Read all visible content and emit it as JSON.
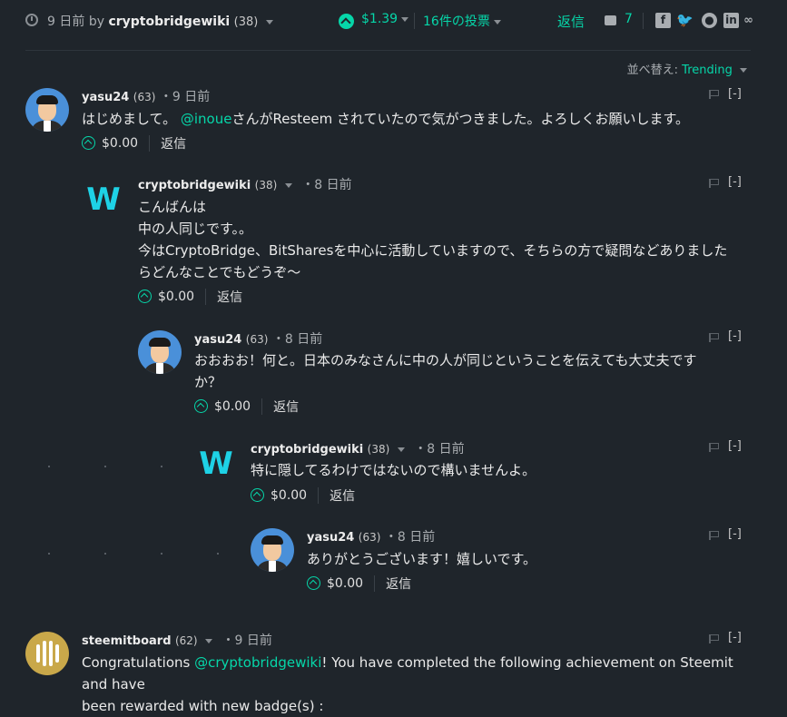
{
  "header": {
    "posted_ago": "9 日前",
    "by_label": "by",
    "author": "cryptobridgewiki",
    "author_rep": "(38)",
    "payout": "$1.39",
    "votes": "16件の投票",
    "reply": "返信",
    "comment_count": "7",
    "share_icons": [
      "facebook-icon",
      "twitter-icon",
      "reddit-icon",
      "linkedin-icon",
      "link-icon"
    ]
  },
  "sort": {
    "label": "並べ替え:",
    "value": "Trending"
  },
  "colors": {
    "accent": "#06d6a9",
    "background": "#1f252b"
  },
  "comments": [
    {
      "author": "yasu24",
      "rep": "(63)",
      "time": "・9 日前",
      "text_before": "はじめまして。 ",
      "mention": "@inoue",
      "text_after": "さんがResteem されていたので気がつきました。よろしくお願いします。",
      "payout": "$0.00",
      "reply": "返信",
      "collapse": "[-]"
    },
    {
      "author": "cryptobridgewiki",
      "rep": "(38)",
      "time": "・8 日前",
      "lines": [
        "こんばんは",
        "中の人同じです。。",
        "今はCryptoBridge、BitSharesを中心に活動していますので、そちらの方で疑問などありました",
        "らどんなことでもどうぞ〜"
      ],
      "payout": "$0.00",
      "reply": "返信",
      "collapse": "[-]"
    },
    {
      "author": "yasu24",
      "rep": "(63)",
      "time": "・8 日前",
      "lines": [
        "おおおお！何と。日本のみなさんに中の人が同じということを伝えても大丈夫です",
        "か？"
      ],
      "payout": "$0.00",
      "reply": "返信",
      "collapse": "[-]"
    },
    {
      "author": "cryptobridgewiki",
      "rep": "(38)",
      "time": "・8 日前",
      "lines": [
        "特に隠してるわけではないので構いませんよ。"
      ],
      "payout": "$0.00",
      "reply": "返信",
      "collapse": "[-]"
    },
    {
      "author": "yasu24",
      "rep": "(63)",
      "time": "・8 日前",
      "lines": [
        "ありがとうございます！嬉しいです。"
      ],
      "payout": "$0.00",
      "reply": "返信",
      "collapse": "[-]"
    },
    {
      "author": "steemitboard",
      "rep": "(62)",
      "time": "・9 日前",
      "text_before": "Congratulations ",
      "mention": "@cryptobridgewiki",
      "text_after": "! You have completed the following achievement on Steemit and have",
      "line2": "been rewarded with new badge(s) :",
      "collapse": "[-]"
    }
  ]
}
